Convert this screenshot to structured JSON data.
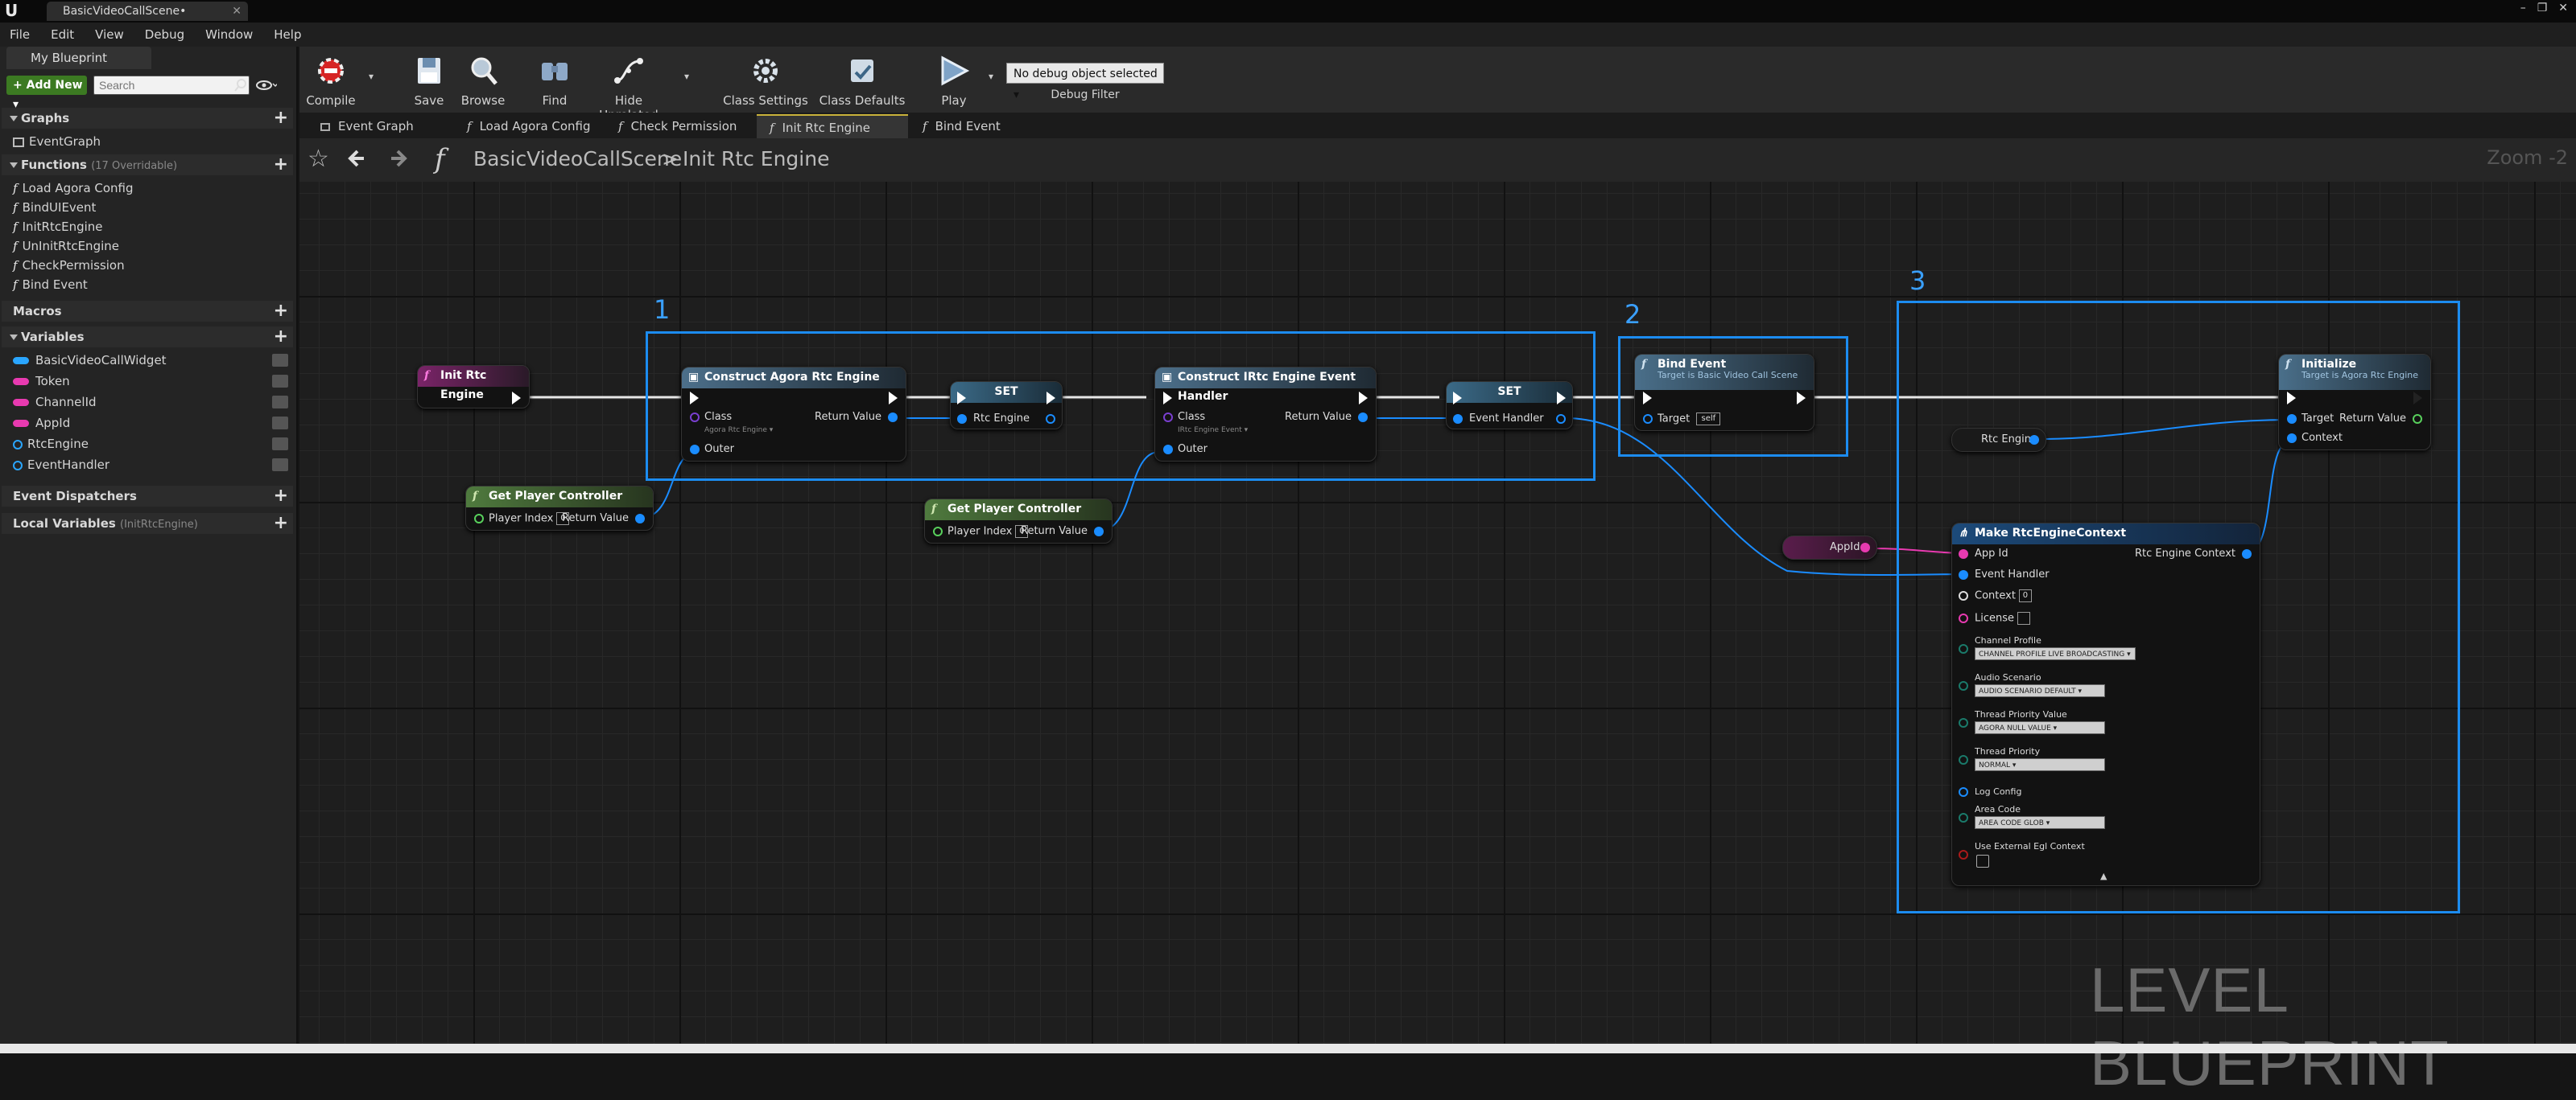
{
  "window": {
    "doc_tab": "BasicVideoCallScene•",
    "logo": "U"
  },
  "menu": [
    "File",
    "Edit",
    "View",
    "Debug",
    "Window",
    "Help"
  ],
  "left": {
    "panel_tab": "My Blueprint",
    "add_new": "+ Add New ▾",
    "search_placeholder": "Search",
    "graphs_label": "Graphs",
    "graphs": [
      "EventGraph"
    ],
    "functions_label": "Functions",
    "functions_sub": "(17 Overridable)",
    "functions": [
      "Load Agora Config",
      "BindUIEvent",
      "InitRtcEngine",
      "UnInitRtcEngine",
      "CheckPermission",
      "Bind Event"
    ],
    "macros_label": "Macros",
    "variables_label": "Variables",
    "variables": [
      {
        "name": "BasicVideoCallWidget",
        "color": "#2aa6ff",
        "kind": "pill"
      },
      {
        "name": "Token",
        "color": "#e83ab0",
        "kind": "pill"
      },
      {
        "name": "ChannelId",
        "color": "#e83ab0",
        "kind": "pill"
      },
      {
        "name": "AppId",
        "color": "#e83ab0",
        "kind": "pill"
      },
      {
        "name": "RtcEngine",
        "color": "#2aa6ff",
        "kind": "ring"
      },
      {
        "name": "EventHandler",
        "color": "#2aa6ff",
        "kind": "ring"
      }
    ],
    "dispatchers_label": "Event Dispatchers",
    "local_vars_label": "Local Variables",
    "local_vars_sub": "(InitRtcEngine)"
  },
  "toolbar": {
    "compile": "Compile",
    "save": "Save",
    "browse": "Browse",
    "find": "Find",
    "hide_unrelated": "Hide Unrelated",
    "class_settings": "Class Settings",
    "class_defaults": "Class Defaults",
    "play": "Play",
    "debug_select": "No debug object selected ▾",
    "debug_filter": "Debug Filter"
  },
  "tabs": [
    "Event Graph",
    "Load Agora Config",
    "Check Permission",
    "Init Rtc Engine",
    "Bind Event"
  ],
  "breadcrumb": {
    "scene": "BasicVideoCallScene",
    "sep": ">",
    "func": "Init Rtc Engine",
    "zoom": "Zoom -2"
  },
  "watermark": "LEVEL BLUEPRINT",
  "comments": [
    "1",
    "2",
    "3"
  ],
  "nodes": {
    "init": {
      "title": "Init Rtc Engine"
    },
    "gpc": {
      "title": "Get Player Controller",
      "player_index": "Player Index",
      "idx": "0",
      "ret": "Return Value"
    },
    "construct1": {
      "title": "Construct Agora Rtc Engine",
      "class": "Class",
      "class_val": "Agora Rtc Engine ▾",
      "ret": "Return Value",
      "outer": "Outer"
    },
    "set1": {
      "title": "SET",
      "pin": "Rtc Engine"
    },
    "construct2": {
      "title": "Construct IRtc Engine Event Handler",
      "class": "Class",
      "class_val": "IRtc Engine Event ▾",
      "ret": "Return Value",
      "outer": "Outer"
    },
    "set2": {
      "title": "SET",
      "pin": "Event Handler"
    },
    "bind": {
      "title": "Bind Event",
      "sub": "Target is Basic Video Call Scene",
      "target": "Target",
      "self": "self"
    },
    "rtc_get": {
      "label": "Rtc Engine"
    },
    "appid_get": {
      "label": "AppId"
    },
    "init_node": {
      "title": "Initialize",
      "sub": "Target is Agora Rtc Engine",
      "target": "Target",
      "ret": "Return Value",
      "context": "Context"
    },
    "make": {
      "title": "Make RtcEngineContext",
      "out": "Rtc Engine Context",
      "pins": [
        "App Id",
        "Event Handler",
        "Context",
        "License"
      ],
      "context_val": "0",
      "channel_profile": "Channel Profile",
      "channel_profile_val": "CHANNEL PROFILE LIVE BROADCASTING ▾",
      "audio_scenario": "Audio Scenario",
      "audio_scenario_val": "AUDIO SCENARIO DEFAULT ▾",
      "thread_priority_value": "Thread Priority Value",
      "thread_priority_value_val": "AGORA NULL VALUE ▾",
      "thread_priority": "Thread Priority",
      "thread_priority_val": "NORMAL ▾",
      "log_config": "Log Config",
      "area_code": "Area Code",
      "area_code_val": "AREA CODE GLOB ▾",
      "use_ext": "Use External Egl Context"
    }
  },
  "colors": {
    "comment_border": "#1c8cf0",
    "func_header": "#3b6a87",
    "getter_header": "#4e6b3a",
    "event_header": "#6b1f5a",
    "pink": "#e83ab0",
    "blue": "#1a8cff"
  }
}
